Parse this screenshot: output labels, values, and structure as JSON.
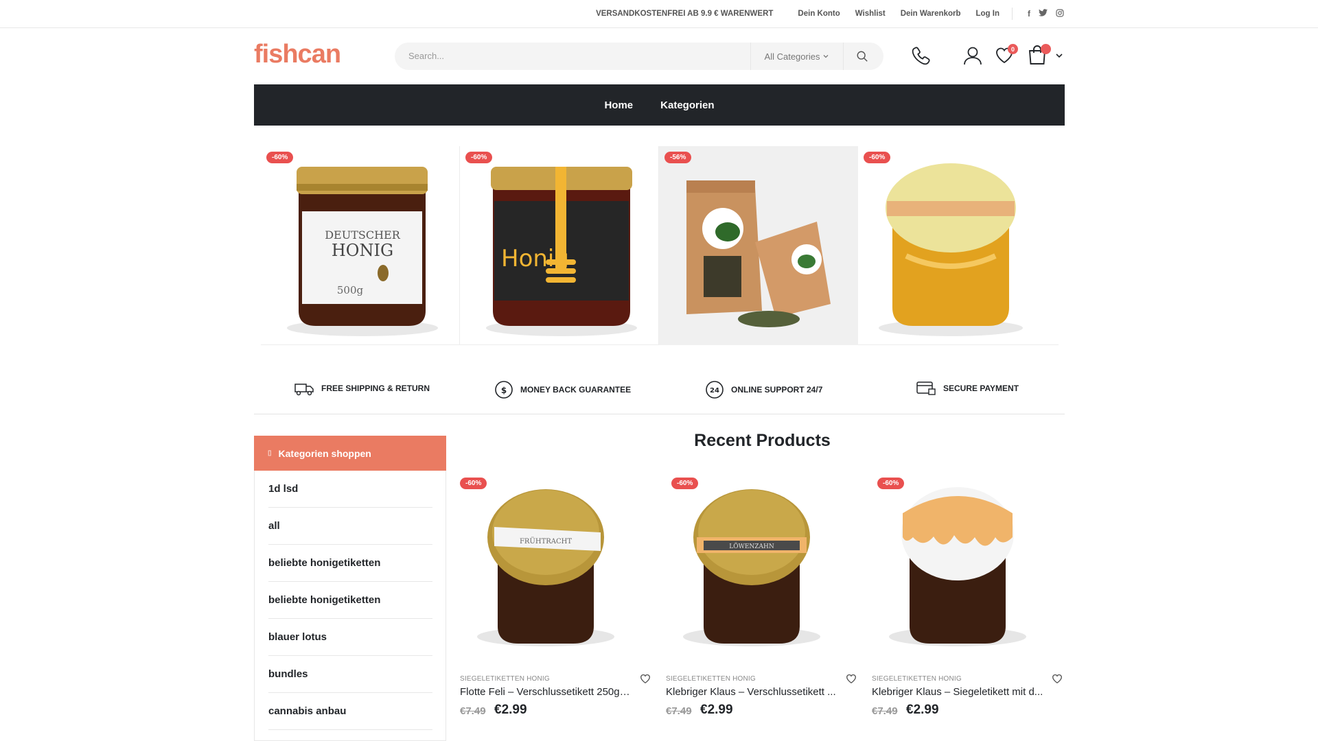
{
  "topbar": {
    "promo": "VERSANDKOSTENFREI AB 9.9 € WARENWERT",
    "links": [
      "Dein Konto",
      "Wishlist",
      "Dein Warenkorb",
      "Log In"
    ],
    "social": [
      "facebook-icon",
      "twitter-icon",
      "instagram-icon"
    ]
  },
  "header": {
    "logo": "fishcan",
    "search_placeholder": "Search...",
    "category_select": "All Categories",
    "wishlist_count": "0",
    "cart_count": ""
  },
  "nav": {
    "items": [
      "Home",
      "Kategorien"
    ]
  },
  "hero": {
    "items": [
      {
        "discount": "-60%",
        "image": "honey-jar-deutscher-honig"
      },
      {
        "discount": "-60%",
        "image": "honey-jar-black-label"
      },
      {
        "discount": "-56%",
        "image": "tea-bags"
      },
      {
        "discount": "-60%",
        "image": "honey-jar-clear"
      }
    ]
  },
  "features": [
    "FREE SHIPPING & RETURN",
    "MONEY BACK GUARANTEE",
    "ONLINE SUPPORT 24/7",
    "SECURE PAYMENT"
  ],
  "sidebar": {
    "title": "Kategorien shoppen",
    "items": [
      "1d lsd",
      "all",
      "beliebte honigetiketten",
      "beliebte honigetiketten",
      "blauer lotus",
      "bundles",
      "cannabis anbau"
    ]
  },
  "recent": {
    "title": "Recent Products",
    "products": [
      {
        "discount": "-60%",
        "category": "SIEGELETIKETTEN HONIG",
        "name": "Flotte Feli – Verschlussetikett 250g (...",
        "old_price": "€7.49",
        "price": "€2.99",
        "label": "FRÜHTRACHT"
      },
      {
        "discount": "-60%",
        "category": "SIEGELETIKETTEN HONIG",
        "name": "Klebriger Klaus – Verschlussetikett ...",
        "old_price": "€7.49",
        "price": "€2.99",
        "label": "LÖWENZAHN"
      },
      {
        "discount": "-60%",
        "category": "SIEGELETIKETTEN HONIG",
        "name": "Klebriger Klaus – Siegeletikett mit d...",
        "old_price": "€7.49",
        "price": "€2.99",
        "label": ""
      }
    ]
  },
  "colors": {
    "accent": "#ea7b62",
    "nav_bg": "#222529",
    "discount": "#e9504f"
  }
}
